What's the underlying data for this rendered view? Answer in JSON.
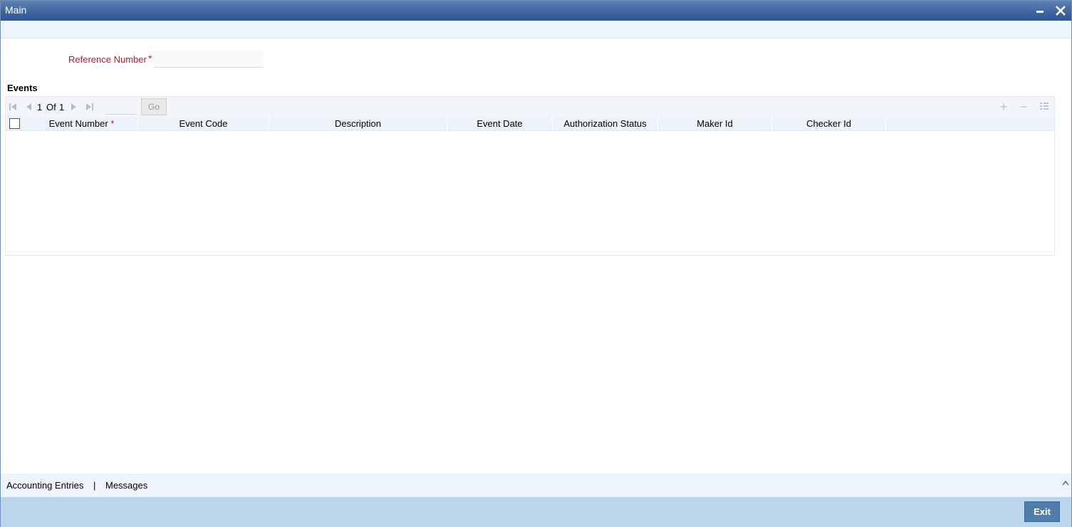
{
  "window": {
    "title": "Main"
  },
  "form": {
    "reference_label": "Reference Number",
    "required_mark": "*",
    "reference_value": ""
  },
  "events": {
    "section_title": "Events",
    "pager": {
      "current": "1",
      "of_label": "Of",
      "total": "1",
      "go_label": "Go"
    },
    "columns": [
      "Event Number",
      "Event Code",
      "Description",
      "Event Date",
      "Authorization Status",
      "Maker Id",
      "Checker Id"
    ],
    "rows": []
  },
  "footer": {
    "tabs": [
      "Accounting Entries",
      "Messages"
    ],
    "separator": "|",
    "exit_label": "Exit"
  },
  "colors": {
    "titlebar": "#3f66a0",
    "required": "#c8102e",
    "bottombar": "#bcd5ea",
    "exit_button": "#4f7ead"
  }
}
